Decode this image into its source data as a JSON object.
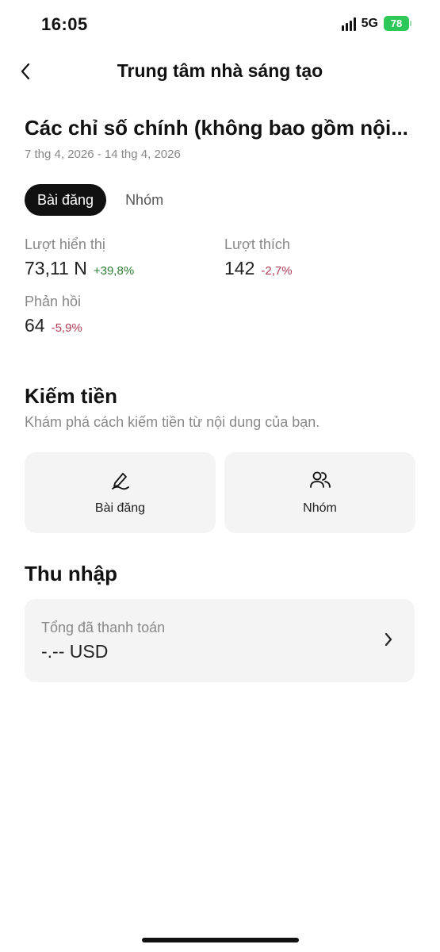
{
  "status_bar": {
    "time": "16:05",
    "network": "5G",
    "battery": "78",
    "battery_color": "#2ec759"
  },
  "nav": {
    "title": "Trung tâm nhà sáng tạo",
    "back_icon": "chevron-left-icon"
  },
  "metrics": {
    "title": "Các chỉ số chính (không bao gồm nội...",
    "date_range": "7 thg 4, 2026 - 14 thg 4, 2026",
    "tabs": [
      {
        "label": "Bài đăng",
        "active": true
      },
      {
        "label": "Nhóm",
        "active": false
      }
    ],
    "items": [
      {
        "label": "Lượt hiển thị",
        "value": "73,11 N",
        "change": "+39,8%",
        "trend": "up"
      },
      {
        "label": "Lượt thích",
        "value": "142",
        "change": "-2,7%",
        "trend": "down"
      },
      {
        "label": "Phản hồi",
        "value": "64",
        "change": "-5,9%",
        "trend": "down"
      }
    ],
    "up_color": "#2e7d32",
    "down_color": "#b23a55"
  },
  "monetization": {
    "title": "Kiếm tiền",
    "description": "Khám phá cách kiếm tiền từ nội dung của bạn.",
    "cards": [
      {
        "label": "Bài đăng",
        "icon": "pen-icon"
      },
      {
        "label": "Nhóm",
        "icon": "people-icon"
      }
    ]
  },
  "income": {
    "title": "Thu nhập",
    "label": "Tổng đã thanh toán",
    "value": "-.-- USD",
    "icon": "chevron-right-icon"
  }
}
